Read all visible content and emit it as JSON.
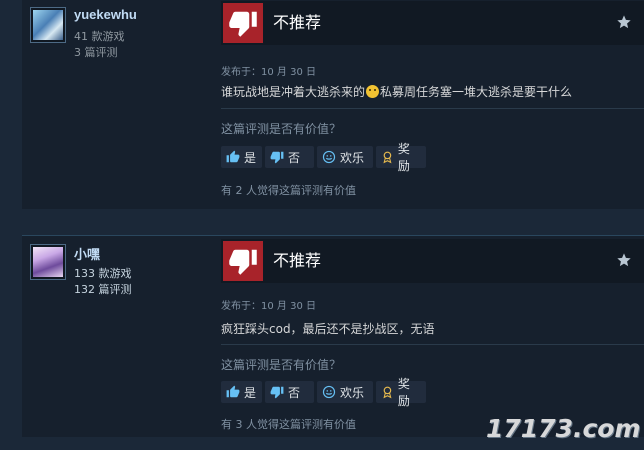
{
  "reviews": [
    {
      "author": {
        "name": "yuekewhu",
        "games": "41 款游戏",
        "reviews": "3 篇评测"
      },
      "verdict": "不推荐",
      "posted": "发布于：10 月 30 日",
      "content_before": "谁玩战地是冲着大逃杀来的",
      "content_after": "私募周任务塞一堆大逃杀是要干什么",
      "helpful_question": "这篇评测是否有价值？",
      "buttons": {
        "yes": "是",
        "no": "否",
        "funny": "欢乐",
        "award": "奖励"
      },
      "found_helpful": "有 2 人觉得这篇评测有价值"
    },
    {
      "author": {
        "name": "小嘿",
        "games": "133 款游戏",
        "reviews": "132 篇评测"
      },
      "verdict": "不推荐",
      "posted": "发布于：10 月 30 日",
      "content": "疯狂踩头cod，最后还不是抄战区，无语",
      "helpful_question": "这篇评测是否有价值？",
      "buttons": {
        "yes": "是",
        "no": "否",
        "funny": "欢乐",
        "award": "奖励"
      },
      "found_helpful": "有 3 人觉得这篇评测有价值"
    }
  ],
  "watermark": "17173.com",
  "colors": {
    "background": "#1b2838",
    "card": "#16202d",
    "not_recommended": "#a8232a",
    "link": "#66c0f4"
  }
}
